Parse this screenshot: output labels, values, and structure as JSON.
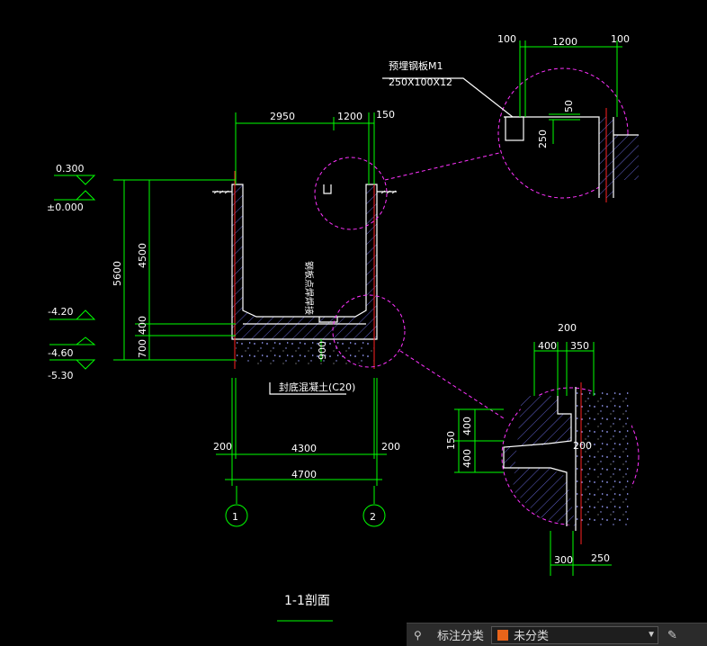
{
  "drawing": {
    "title": "1-1剖面",
    "annotation_cn": "封底混凝土(C20)",
    "plate_label": "预埋钢板M1",
    "plate_size": "250X100X12",
    "vertical_note": "钢板点焊焊接",
    "grid_left": "1",
    "grid_right": "2",
    "elevations": [
      "0.300",
      "±0.000",
      "-4.20",
      "-4.60",
      "-5.30"
    ],
    "dims_main": {
      "top_a": "2950",
      "top_b": "1200",
      "top_c": "150",
      "h_total": "5600",
      "h_inner": "4500",
      "h_400": "400",
      "h_700": "700",
      "inner_900": "900",
      "bot_200_l": "200",
      "bot_4300": "4300",
      "bot_200_r": "200",
      "bot_4700": "4700"
    },
    "detail_top": {
      "d100a": "100",
      "d1200": "1200",
      "d100b": "100",
      "d50": "50",
      "d250": "250"
    },
    "detail_bot": {
      "d200": "200",
      "d400": "400",
      "d350": "350",
      "d400v1": "400",
      "d400v2": "400",
      "d150": "150",
      "d200b": "200",
      "d300": "300",
      "d250": "250"
    }
  },
  "statusbar": {
    "label": "标注分类",
    "value": "未分类",
    "swatch_color": "#e8641a"
  },
  "colors": {
    "background": "#000000",
    "dimension": "#00ff00",
    "outline": "#ffffff",
    "detail_circle": "#ff33ff",
    "axis": "#ff2222"
  }
}
